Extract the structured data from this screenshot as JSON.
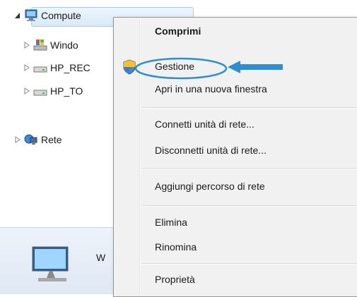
{
  "tree": {
    "items": [
      {
        "label": "Compute",
        "expanded": true,
        "selected": true,
        "icon": "computer-icon"
      },
      {
        "label": "Windo",
        "icon": "windows-drive-icon"
      },
      {
        "label": "HP_REC",
        "icon": "drive-icon"
      },
      {
        "label": "HP_TO",
        "icon": "drive-icon"
      },
      {
        "label": "Rete",
        "icon": "network-icon"
      }
    ]
  },
  "details": {
    "text": "W"
  },
  "context_menu": {
    "items": [
      {
        "label": "Comprimi",
        "bold": true
      },
      {
        "label": "Gestione",
        "icon": "shield-icon",
        "highlighted_annotation": true
      },
      {
        "label": "Apri in una nuova finestra"
      },
      {
        "label": "Connetti unità di rete..."
      },
      {
        "label": "Disconnetti unità di rete..."
      },
      {
        "label": "Aggiungi percorso di rete"
      },
      {
        "label": "Elimina"
      },
      {
        "label": "Rinomina"
      },
      {
        "label": "Proprietà"
      }
    ]
  },
  "colors": {
    "annotation": "#2e8fd0",
    "menu_bg": "#f1f1f1",
    "selection": "#d6eafb"
  }
}
